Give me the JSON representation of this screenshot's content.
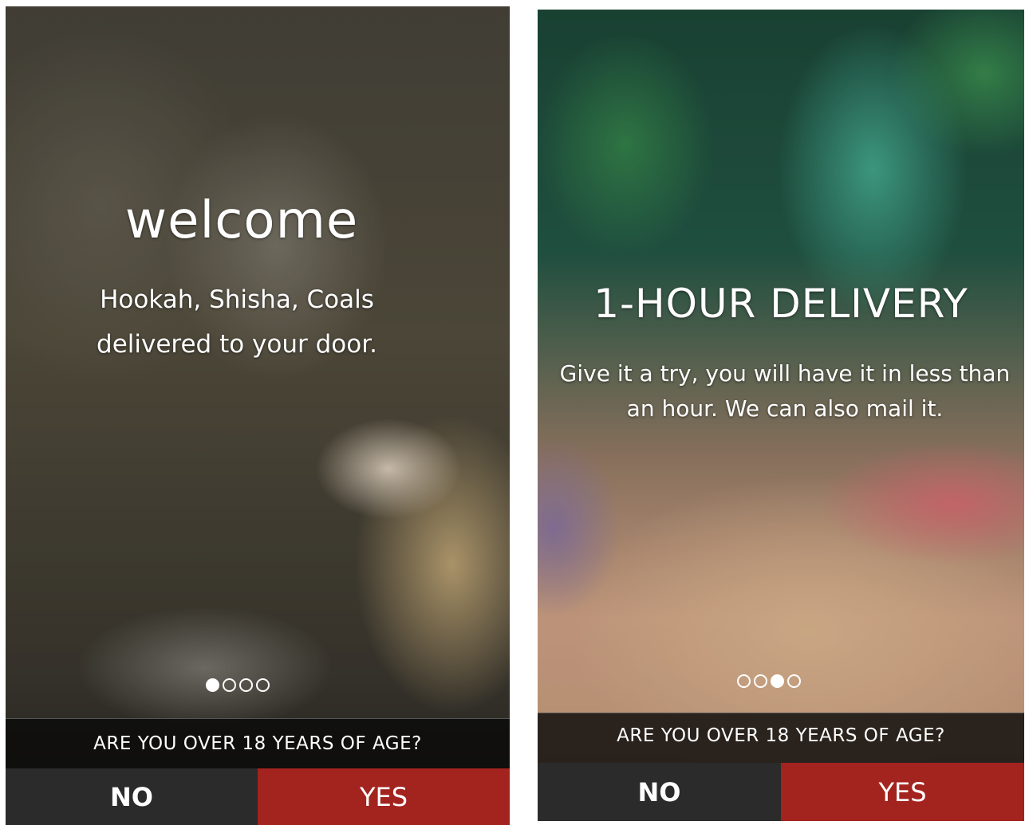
{
  "colors": {
    "no_button": "#2b2b2b",
    "yes_button": "#a3231f",
    "question_bar": "#0a0a0a",
    "text": "#ffffff"
  },
  "screens": [
    {
      "heading": "welcome",
      "subtitle": "Hookah, Shisha, Coals delivered to your door.",
      "pager": {
        "total": 4,
        "active": 1
      },
      "question": "ARE YOU OVER 18 YEARS OF AGE?",
      "no_label": "NO",
      "yes_label": "YES"
    },
    {
      "heading": "1-HOUR DELIVERY",
      "subtitle": "Give it a try, you will have it in less than an hour. We can also mail it.",
      "pager": {
        "total": 4,
        "active": 3
      },
      "question": "ARE YOU OVER 18 YEARS OF AGE?",
      "no_label": "NO",
      "yes_label": "YES"
    }
  ]
}
